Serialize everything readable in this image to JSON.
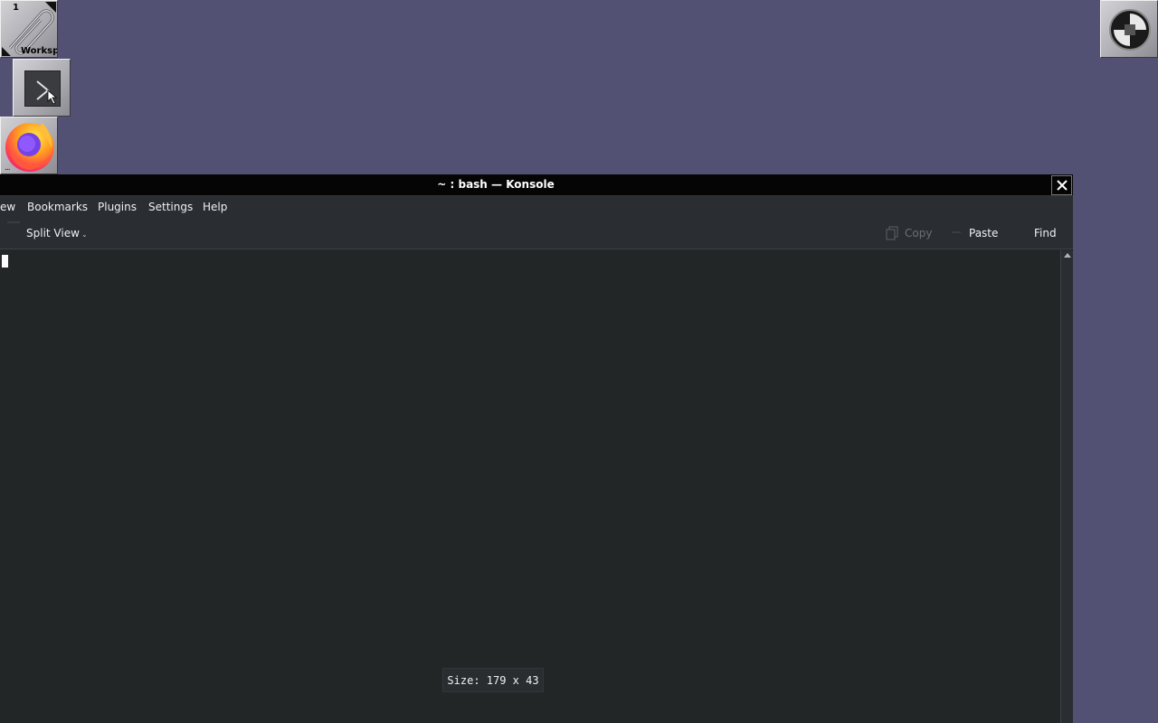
{
  "dock": {
    "clip": {
      "number": "1",
      "label": "Worksp",
      "icon": "paperclip-icon"
    },
    "terminal_launcher": {
      "icon": "terminal-icon"
    },
    "firefox_launcher": {
      "icon": "firefox-icon",
      "dots": "..."
    },
    "right_app": {
      "icon": "app-logo-icon"
    }
  },
  "window": {
    "title": "~ : bash — Konsole",
    "close_icon": "close-icon"
  },
  "menubar": {
    "items": [
      "ew",
      "Bookmarks",
      "Plugins",
      "Settings",
      "Help"
    ]
  },
  "toolbar": {
    "split_view": "Split View",
    "copy": "Copy",
    "paste": "Paste",
    "find": "Find"
  },
  "terminal": {
    "size_popup": "Size: 179 x 43"
  },
  "colors": {
    "desktop": "#525174",
    "terminal_bg": "#232627",
    "titlebar": "#050505",
    "chrome": "#2a2e32"
  }
}
